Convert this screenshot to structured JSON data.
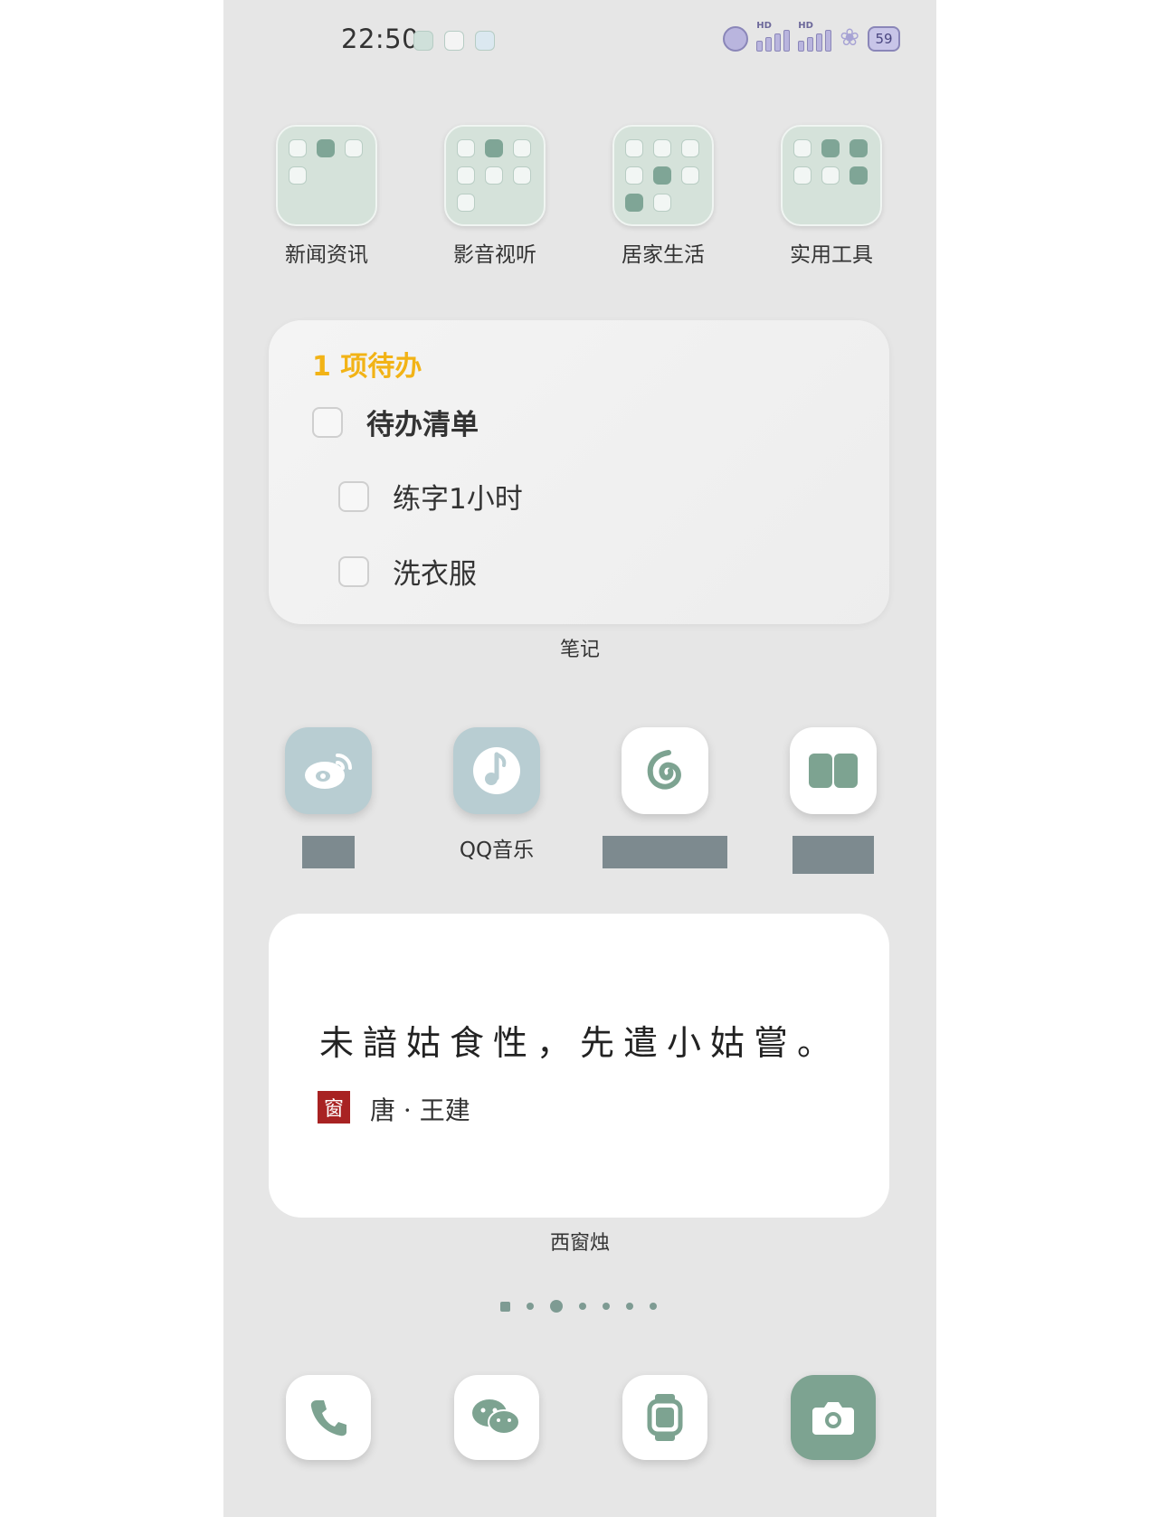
{
  "status_bar": {
    "time": "22:50",
    "left_icons": [
      "app-notification-icon",
      "app-notification-icon",
      "app-notification-icon"
    ],
    "signal_labels": [
      "HD",
      "HD"
    ],
    "battery": "59",
    "theme_color": "#8a86b8"
  },
  "folders": [
    {
      "label": "新闻资讯"
    },
    {
      "label": "影音视听"
    },
    {
      "label": "居家生活"
    },
    {
      "label": "实用工具"
    }
  ],
  "notes_widget": {
    "count_text": "1 项待办",
    "items": [
      {
        "text": "待办清单",
        "checked": false
      },
      {
        "text": "练字1小时",
        "checked": false
      },
      {
        "text": "洗衣服",
        "checked": false
      }
    ],
    "label": "笔记"
  },
  "apps": [
    {
      "name": "",
      "icon": "weibo-icon"
    },
    {
      "name": "QQ音乐",
      "icon": "qq-music-icon"
    },
    {
      "name": "",
      "icon": "netease-music-icon"
    },
    {
      "name": "",
      "icon": "book-icon"
    }
  ],
  "poem_widget": {
    "verse": "未諳姑食性，先遣小姑嘗。",
    "seal": "窗",
    "author": "唐 · 王建",
    "label": "西窗烛"
  },
  "dock": [
    {
      "icon": "phone-icon"
    },
    {
      "icon": "wechat-icon"
    },
    {
      "icon": "watch-icon"
    },
    {
      "icon": "camera-icon"
    }
  ],
  "colors": {
    "accent": "#7da391",
    "todo_count": "#f2b316",
    "seal": "#a82222"
  }
}
